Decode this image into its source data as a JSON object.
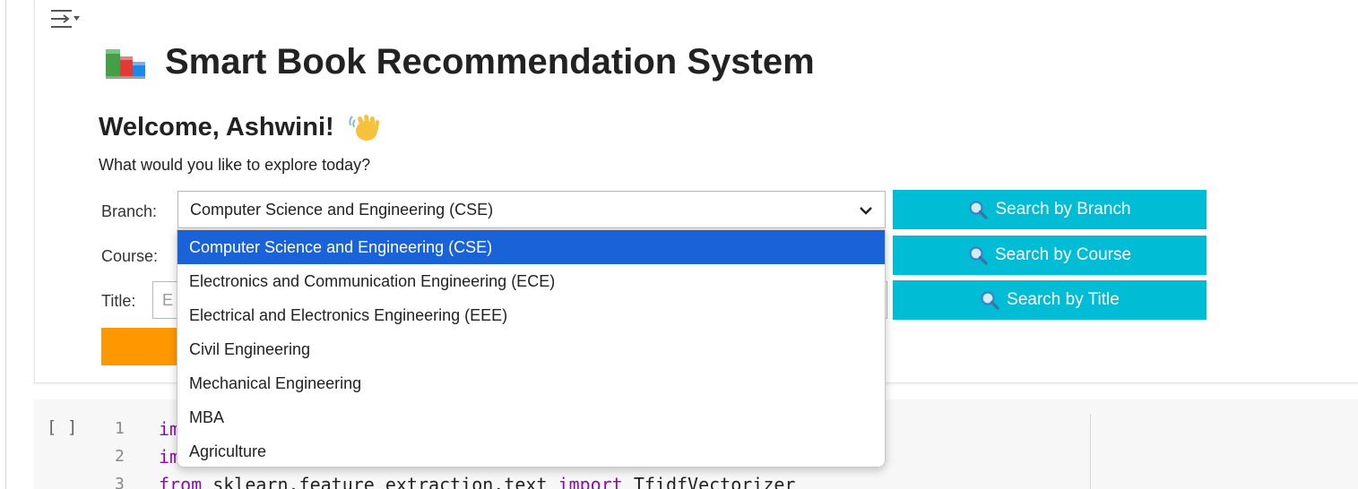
{
  "app": {
    "title": "Smart Book Recommendation System",
    "welcome": "Welcome, Ashwini!",
    "subtitle": "What would you like to explore today?"
  },
  "icons": {
    "output_toggle": "output-toggle-icon",
    "books": "books-icon",
    "wave": "waving-hand-icon",
    "search": "magnifier-icon",
    "chevron": "chevron-down-icon"
  },
  "colors": {
    "search_button": "#00bcd4",
    "action_button": "#ff9800",
    "selected_option": "#1a62d8",
    "keyword": "#8a0fa8"
  },
  "form": {
    "branch_label": "Branch:",
    "course_label": "Course:",
    "title_label": "Title:",
    "branch_selected": "Computer Science and Engineering (CSE)",
    "title_placeholder": "E"
  },
  "buttons": {
    "search_branch": "Search by Branch",
    "search_course": "Search by Course",
    "search_title": "Search by Title"
  },
  "dropdown": {
    "options": [
      "Computer Science and Engineering (CSE)",
      "Electronics and Communication Engineering (ECE)",
      "Electrical and Electronics Engineering (EEE)",
      "Civil Engineering",
      "Mechanical Engineering",
      "MBA",
      "Agriculture"
    ],
    "selected_index": 0
  },
  "code": {
    "run_indicator": "[ ]",
    "lines": [
      {
        "num": "1",
        "kw": "im",
        "rest": ""
      },
      {
        "num": "2",
        "kw": "im",
        "rest": ""
      },
      {
        "num": "3",
        "kw": "from",
        "rest": " sklearn.feature_extraction.text ",
        "kw2": "import",
        "rest2": " TfidfVectorizer"
      }
    ]
  }
}
